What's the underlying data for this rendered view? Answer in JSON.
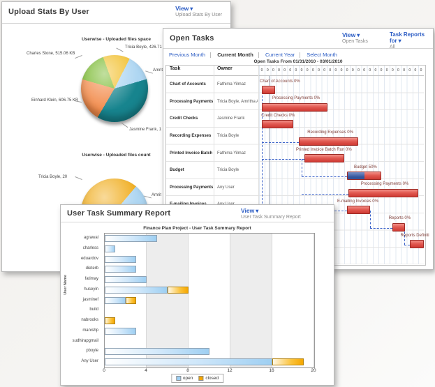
{
  "upload_stats": {
    "title": "Upload Stats By User",
    "view": {
      "label": "View",
      "sub": "Upload Stats By User"
    }
  },
  "open_tasks": {
    "title": "Open Tasks",
    "view": {
      "label": "View",
      "sub": "Open Tasks"
    },
    "task_reports": {
      "label": "Task Reports for",
      "sub": "All"
    },
    "nav": [
      {
        "label": "Previous Month",
        "active": false
      },
      {
        "label": "Current Month",
        "active": true
      },
      {
        "label": "Current Year",
        "active": false
      },
      {
        "label": "Select Month",
        "active": false
      }
    ],
    "columns": {
      "task": "Task",
      "owner": "Owner"
    },
    "rows": [
      {
        "task": "Chart of Accounts",
        "owner": "Fathima Yilmaz"
      },
      {
        "task": "Processing Payments",
        "owner": "Tricia Boyle, Amritha Agraw"
      },
      {
        "task": "Credit Checks",
        "owner": "Jasmine Frank"
      },
      {
        "task": "Recording Expenses",
        "owner": "Tricia Boyle"
      },
      {
        "task": "Printed Invoice Batch Run",
        "owner": "Fathima Yilmaz"
      },
      {
        "task": "Budget",
        "owner": "Tricia Boyle"
      },
      {
        "task": "Processing Payments",
        "owner": "Any User"
      },
      {
        "task": "E-mailing Invoices",
        "owner": "Any User"
      }
    ]
  },
  "task_summary": {
    "title": "User Task Summary Report",
    "view": {
      "label": "View",
      "sub": "User Task Summary Report"
    }
  },
  "chart_data": [
    {
      "type": "pie",
      "title": "Userwise - Uploaded files space",
      "slices": [
        {
          "label": "Tricia Boyle, 426.71 K",
          "share_pct": 13,
          "color": "#f2c02e"
        },
        {
          "label": "Amrit",
          "share_pct": 13,
          "color": "#aed6f2"
        },
        {
          "label": "Jasmine Frank, 1",
          "share_pct": 38,
          "color": "#17848e"
        },
        {
          "label": "Einhard Klein, 606.75 KB",
          "share_pct": 21,
          "color": "#f28b4b"
        },
        {
          "label": "Charles Stone, 515.06 KB",
          "share_pct": 15,
          "color": "#76b82a"
        }
      ]
    },
    {
      "type": "pie",
      "title": "Userwise - Uploaded files count",
      "slices": [
        {
          "label": "Amrit",
          "share_pct": 25,
          "color": "#aed6f2"
        },
        {
          "label": "Tricia Boyle, 20",
          "share_pct": 75,
          "color": "#f0ad1e"
        }
      ]
    },
    {
      "type": "gantt",
      "title": "Open Tasks From 01/31/2010 - 03/01/2010",
      "days": 29,
      "day_tick": "0",
      "today_day": 1.8,
      "bar_color": "#d9413c",
      "progress_color": "#33549b",
      "bars": [
        {
          "row": 0,
          "label": "Chart of Accounts 0%",
          "start": 0.5,
          "end": 2.8,
          "progress": 0
        },
        {
          "row": 1,
          "label": "Processing Payments 0%",
          "start": 0.5,
          "end": 12,
          "progress": 0
        },
        {
          "row": 2,
          "label": "Credit Checks 0%",
          "start": 0.5,
          "end": 6,
          "progress": 0
        },
        {
          "row": 3,
          "label": "Recording Expenses 0%",
          "start": 7,
          "end": 17.5,
          "progress": 0
        },
        {
          "row": 4,
          "label": "Printed Invoice Batch Run 0%",
          "start": 8,
          "end": 15,
          "progress": 0
        },
        {
          "row": 5,
          "label": "Budget 50%",
          "start": 15.5,
          "end": 21.5,
          "progress": 50
        },
        {
          "row": 6,
          "label": "Processing Payments 0%",
          "start": 15.7,
          "end": 28,
          "progress": 0
        },
        {
          "row": 7,
          "label": "E-mailing Invoices 0%",
          "start": 15.5,
          "end": 19.5,
          "progress": 0
        },
        {
          "row": 8,
          "label": "Reports 0%",
          "start": 23.5,
          "end": 25.7,
          "progress": 0
        },
        {
          "row": 9,
          "label": "Reports Definiti",
          "start": 26.5,
          "end": 29,
          "progress": 0
        }
      ],
      "links": [
        {
          "type": "v",
          "day": 0.5,
          "r1": 1.15,
          "r2": 7.85
        },
        {
          "type": "h",
          "row": 3.85,
          "d1": 0.5,
          "d2": 7.0
        },
        {
          "type": "h",
          "row": 4.85,
          "d1": 0.5,
          "d2": 8.0
        },
        {
          "type": "v",
          "day": 7.5,
          "r1": 4.85,
          "r2": 5.85
        },
        {
          "type": "h",
          "row": 5.85,
          "d1": 7.5,
          "d2": 15.5
        },
        {
          "type": "h",
          "row": 6.85,
          "d1": 7.5,
          "d2": 15.7
        },
        {
          "type": "h",
          "row": 7.85,
          "d1": 0.5,
          "d2": 15.5
        },
        {
          "type": "v",
          "day": 19.5,
          "r1": 7.85,
          "r2": 8.85
        },
        {
          "type": "h",
          "row": 8.85,
          "d1": 19.5,
          "d2": 23.5
        },
        {
          "type": "v",
          "day": 25.5,
          "r1": 8.85,
          "r2": 9.85
        },
        {
          "type": "h",
          "row": 9.85,
          "d1": 25.5,
          "d2": 26.5
        }
      ]
    },
    {
      "type": "bar",
      "orientation": "horizontal",
      "stacked": true,
      "title": "Finance Plan Project - User Task Summary Report",
      "ylabel": "User Name",
      "categories": [
        "agrawal",
        "charless",
        "eduardov",
        "dieterb",
        "fatimay",
        "huseyin",
        "jasminef",
        "build",
        "nabrooks",
        "manishp",
        "sudhirapgmail",
        "pboyle",
        "Any User"
      ],
      "series": [
        {
          "name": "open",
          "color": "#9ecff2",
          "values": [
            5,
            1,
            3,
            3,
            4,
            6,
            2,
            0,
            0,
            3,
            0,
            10,
            16
          ]
        },
        {
          "name": "closed",
          "color": "#f5a700",
          "values": [
            0,
            0,
            0,
            0,
            0,
            2,
            1,
            0,
            1,
            0,
            0,
            0,
            3
          ]
        }
      ],
      "xlim": [
        0,
        20
      ],
      "xticks": [
        0,
        4,
        8,
        12,
        16,
        20
      ],
      "legend_position": "bottom"
    }
  ]
}
